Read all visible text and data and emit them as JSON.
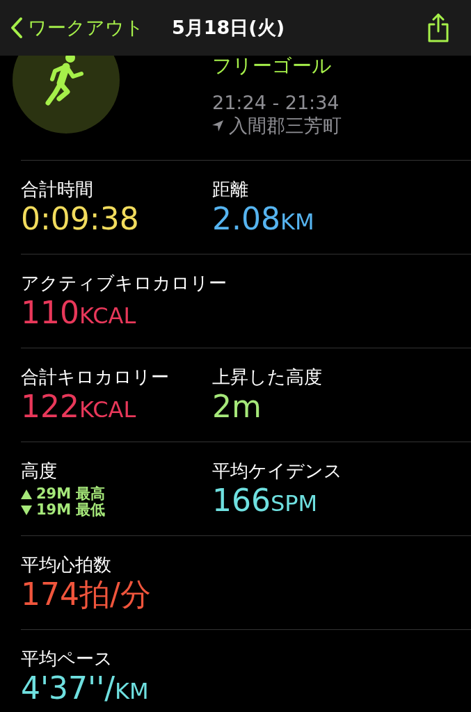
{
  "nav": {
    "back": "ワークアウト",
    "title": "5月18日(火)"
  },
  "header": {
    "goal": "フリーゴール",
    "time": "21:24 - 21:34",
    "location": "入間郡三芳町"
  },
  "rows": [
    {
      "cells": [
        {
          "kind": "value",
          "label": "合計時間",
          "value": "0:09:38",
          "color": "#f2dc5d"
        },
        {
          "kind": "value",
          "label": "距離",
          "value": "2.08",
          "unit": "KM",
          "color": "#56b4f0"
        }
      ]
    },
    {
      "cells": [
        {
          "kind": "value",
          "label": "アクティブキロカロリー",
          "value": "110",
          "unit": "KCAL",
          "color": "#e8385a"
        }
      ]
    },
    {
      "cells": [
        {
          "kind": "value",
          "label": "合計キロカロリー",
          "value": "122",
          "unit": "KCAL",
          "color": "#e8385a"
        },
        {
          "kind": "value",
          "label": "上昇した高度",
          "value": "2m",
          "color": "#a6e87a"
        }
      ]
    },
    {
      "cells": [
        {
          "kind": "range",
          "label": "高度",
          "lines": [
            {
              "kind": "up",
              "text": "29M 最高"
            },
            {
              "kind": "down",
              "text": "19M 最低"
            }
          ],
          "color": "#a6e87a"
        },
        {
          "kind": "value",
          "label": "平均ケイデンス",
          "value": "166",
          "unit": "SPM",
          "color": "#6fe0e0"
        }
      ]
    },
    {
      "cells": [
        {
          "kind": "value",
          "label": "平均心拍数",
          "value": "174拍/分",
          "color": "#f0553c"
        }
      ]
    },
    {
      "cells": [
        {
          "kind": "value",
          "label": "平均ペース",
          "value": "4'37''/",
          "unit": "KM",
          "color": "#6fe0e0"
        }
      ]
    }
  ]
}
